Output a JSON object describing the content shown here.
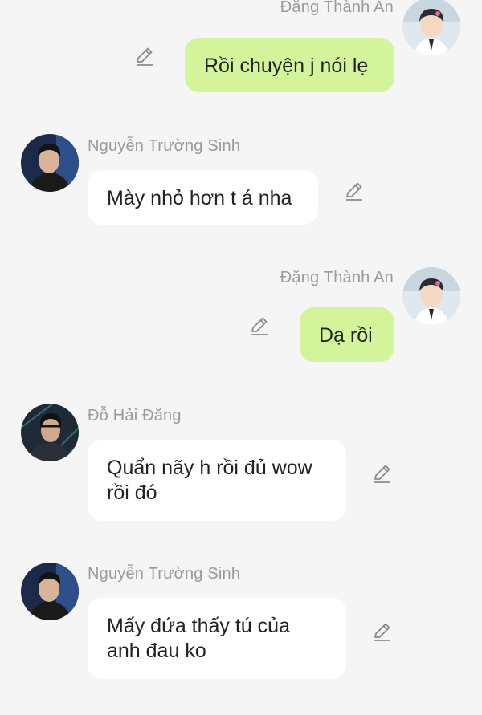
{
  "messages": [
    {
      "id": "m1",
      "direction": "outgoing",
      "sender": "Đặng Thành An",
      "avatar": "avatar-dang-thanh-an",
      "text": "Rồi chuyện j nói lẹ",
      "action_icon": "pencil-icon"
    },
    {
      "id": "m2",
      "direction": "incoming",
      "sender": "Nguyễn Trường Sinh",
      "avatar": "avatar-nguyen-truong-sinh",
      "text": "Mày nhỏ hơn t á nha",
      "action_icon": "pencil-icon"
    },
    {
      "id": "m3",
      "direction": "outgoing",
      "sender": "Đặng Thành An",
      "avatar": "avatar-dang-thanh-an",
      "text": "Dạ rồi",
      "action_icon": "pencil-icon"
    },
    {
      "id": "m4",
      "direction": "incoming",
      "sender": "Đỗ Hải Đăng",
      "avatar": "avatar-do-hai-dang",
      "text": "Quẩn nãy h rồi đủ wow rồi đó",
      "action_icon": "pencil-icon"
    },
    {
      "id": "m5",
      "direction": "incoming",
      "sender": "Nguyễn Trường Sinh",
      "avatar": "avatar-nguyen-truong-sinh",
      "text": "Mấy đứa thấy tú của anh đau ko",
      "action_icon": "pencil-icon"
    }
  ],
  "colors": {
    "background": "#f5f5f5",
    "outgoing_bubble": "#d4f49c",
    "incoming_bubble": "#ffffff",
    "sender_name": "#9a9a9a",
    "message_text": "#222222"
  }
}
